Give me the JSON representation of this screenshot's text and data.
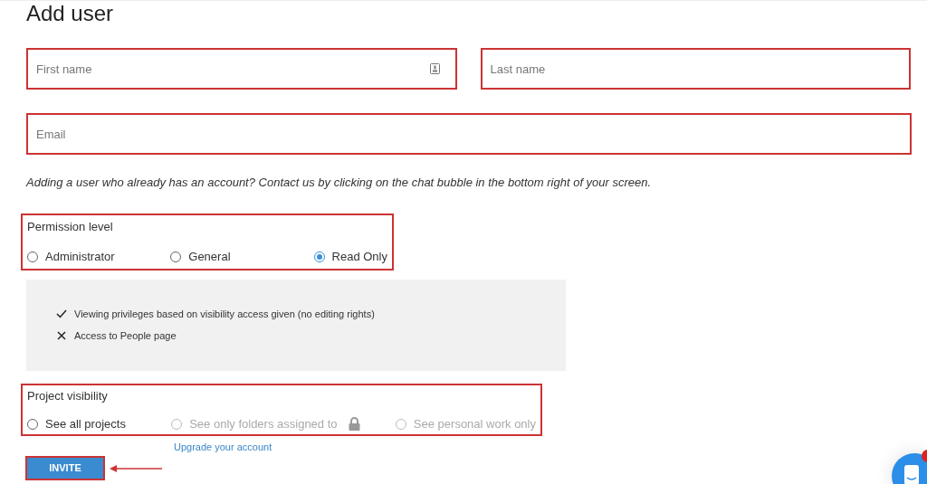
{
  "title": "Add user",
  "fields": [
    {
      "placeholder": "First name",
      "highlighted": true,
      "contact_icon": true
    },
    {
      "placeholder": "Last name",
      "highlighted": true,
      "contact_icon": false
    },
    {
      "placeholder": "Email",
      "highlighted": true,
      "contact_icon": false
    }
  ],
  "note": "Adding a user who already has an account? Contact us by clicking on the chat bubble in the bottom right of your screen.",
  "permission": {
    "label": "Permission level",
    "highlighted": true,
    "options": [
      {
        "label": "Administrator",
        "selected": false
      },
      {
        "label": "General",
        "selected": false
      },
      {
        "label": "Read Only",
        "selected": true
      }
    ]
  },
  "privileges": [
    {
      "kind": "check",
      "text": "Viewing privileges based on visibility access given (no editing rights)"
    },
    {
      "kind": "cross",
      "text": "Access to People page"
    }
  ],
  "visibility": {
    "label": "Project visibility",
    "highlighted": true,
    "options": [
      {
        "label": "See all projects",
        "selected": false,
        "disabled": false,
        "locked": false
      },
      {
        "label": "See only folders assigned to",
        "selected": false,
        "disabled": true,
        "locked": true
      },
      {
        "label": "See personal work only",
        "selected": false,
        "disabled": true,
        "locked": false
      }
    ]
  },
  "upgrade_link": "Upgrade your account",
  "invite_button": {
    "label": "INVITE",
    "highlighted": true
  }
}
